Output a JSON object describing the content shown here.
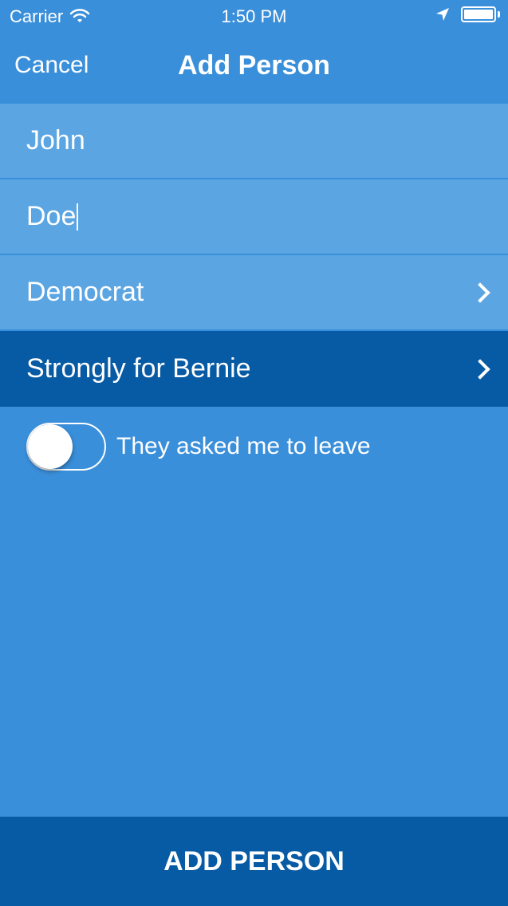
{
  "status_bar": {
    "carrier": "Carrier",
    "time": "1:50 PM"
  },
  "nav": {
    "cancel_label": "Cancel",
    "title": "Add Person"
  },
  "form": {
    "first_name_value": "John",
    "last_name_value": "Doe",
    "party_value": "Democrat",
    "support_value": "Strongly for Bernie",
    "leave_toggle_label": "They asked me to leave",
    "leave_toggle_on": false
  },
  "footer": {
    "add_button_label": "ADD PERSON"
  },
  "colors": {
    "background": "#3a8fda",
    "input_row": "#5aa5e2",
    "selected_row": "#075aa4",
    "button": "#075aa4"
  }
}
